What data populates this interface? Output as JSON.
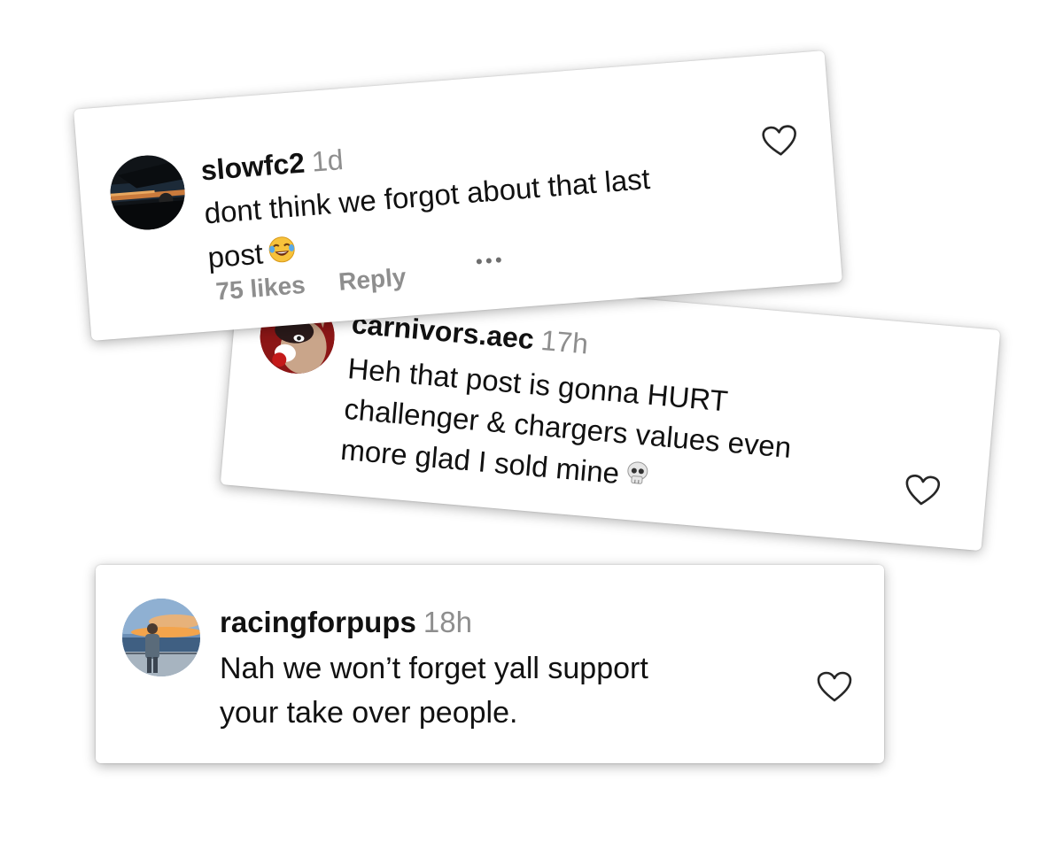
{
  "comments": [
    {
      "username": "slowfc2",
      "time": "1d",
      "lines": [
        "dont think we forgot about that last",
        "post"
      ],
      "emoji_icon": "joy-emoji-icon",
      "likes": "75 likes",
      "reply": "Reply",
      "more_icon": "more-options-icon",
      "like_icon": "heart-outline-icon",
      "avatar": "avatar-night-car-photo"
    },
    {
      "username": "carnivors.aec",
      "time": "17h",
      "lines": [
        "Heh that post is gonna HURT",
        "challenger & chargers values even",
        "more glad I sold mine"
      ],
      "emoji_icon": "skull-emoji-icon",
      "like_icon": "heart-outline-icon",
      "avatar": "avatar-cartoon-fox"
    },
    {
      "username": "racingforpups",
      "time": "18h",
      "lines": [
        "Nah we won’t forget yall support",
        "your take over people."
      ],
      "like_icon": "heart-outline-icon",
      "avatar": "avatar-sunset-person"
    }
  ],
  "colors": {
    "username": "#111111",
    "muted": "#8e8e8e",
    "card_bg": "#ffffff"
  }
}
